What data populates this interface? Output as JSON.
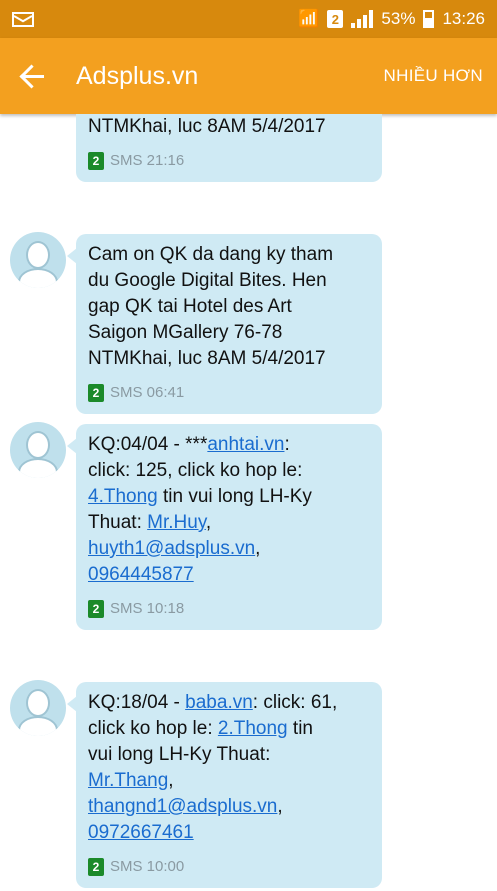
{
  "status_bar": {
    "battery": "53%",
    "time": "13:26",
    "sim": "2"
  },
  "app_bar": {
    "title": "Adsplus.vn",
    "more": "NHIỀU HƠN"
  },
  "messages": [
    {
      "lines": [
        [
          {
            "t": "NTMKhai, luc 8AM 5/4/2017"
          }
        ]
      ],
      "sim": "2",
      "meta": "SMS 21:16"
    },
    {
      "lines": [
        [
          {
            "t": "Cam on QK da dang ky tham"
          }
        ],
        [
          {
            "t": "du Google Digital Bites. Hen"
          }
        ],
        [
          {
            "t": "gap QK tai Hotel des Art"
          }
        ],
        [
          {
            "t": "Saigon MGallery 76-78"
          }
        ],
        [
          {
            "t": "NTMKhai, luc 8AM 5/4/2017"
          }
        ]
      ],
      "sim": "2",
      "meta": "SMS 06:41"
    },
    {
      "lines": [
        [
          {
            "t": "KQ:04/04 - ***"
          },
          {
            "t": "anhtai.vn",
            "link": true
          },
          {
            "t": ":"
          }
        ],
        [
          {
            "t": "click: 125, click ko hop le:"
          }
        ],
        [
          {
            "t": "4.Thong",
            "link": true
          },
          {
            "t": " tin vui long LH-Ky"
          }
        ],
        [
          {
            "t": "Thuat: "
          },
          {
            "t": "Mr.Huy",
            "link": true
          },
          {
            "t": ","
          }
        ],
        [
          {
            "t": "huyth1@adsplus.vn",
            "link": true
          },
          {
            "t": ","
          }
        ],
        [
          {
            "t": "0964445877",
            "link": true
          }
        ]
      ],
      "sim": "2",
      "meta": "SMS 10:18"
    },
    {
      "lines": [
        [
          {
            "t": "KQ:18/04 - "
          },
          {
            "t": "baba.vn",
            "link": true
          },
          {
            "t": ": click: 61,"
          }
        ],
        [
          {
            "t": "click ko hop le: "
          },
          {
            "t": "2.Thong",
            "link": true
          },
          {
            "t": " tin"
          }
        ],
        [
          {
            "t": "vui long LH-Ky Thuat:"
          }
        ],
        [
          {
            "t": "Mr.Thang",
            "link": true
          },
          {
            "t": ","
          }
        ],
        [
          {
            "t": "thangnd1@adsplus.vn",
            "link": true
          },
          {
            "t": ","
          }
        ],
        [
          {
            "t": "0972667461",
            "link": true
          }
        ]
      ],
      "sim": "2",
      "meta": "SMS 10:00"
    }
  ]
}
